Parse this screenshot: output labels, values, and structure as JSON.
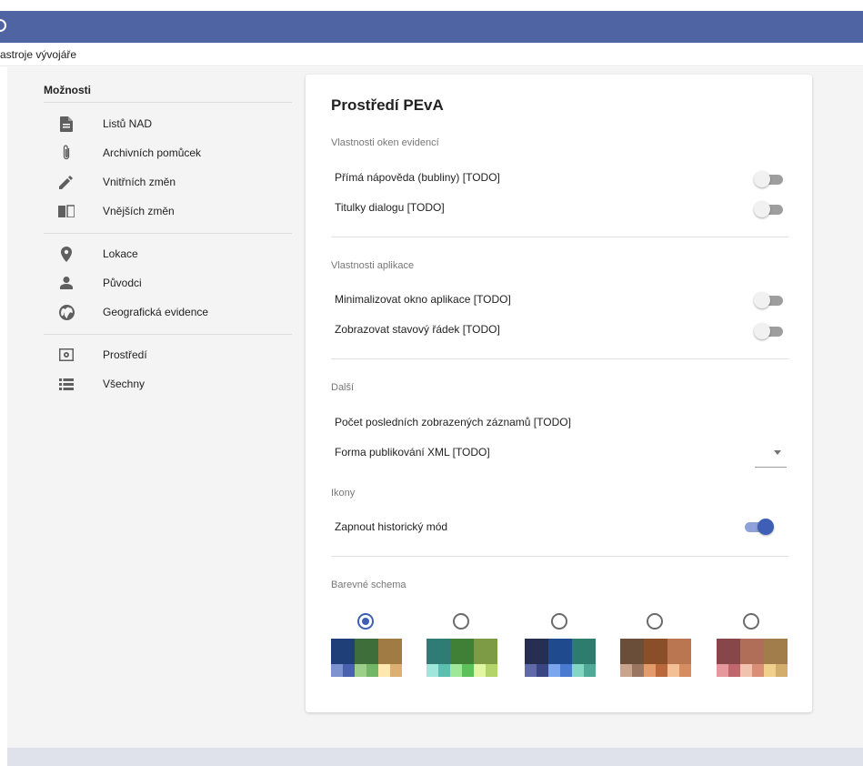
{
  "menubar": {
    "title": "astroje vývojáře"
  },
  "sidebar": {
    "title": "Možnosti",
    "groups": [
      [
        {
          "label": "Listů NAD",
          "icon": "document-icon"
        },
        {
          "label": "Archivních pomůcek",
          "icon": "paperclip-icon"
        },
        {
          "label": "Vnitřních změn",
          "icon": "pencil-icon"
        },
        {
          "label": "Vnějších změn",
          "icon": "book-icon"
        }
      ],
      [
        {
          "label": "Lokace",
          "icon": "location-pin-icon"
        },
        {
          "label": "Původci",
          "icon": "person-icon"
        },
        {
          "label": "Geografická evidence",
          "icon": "globe-icon"
        }
      ],
      [
        {
          "label": "Prostředí",
          "icon": "settings-panel-icon"
        },
        {
          "label": "Všechny",
          "icon": "list-icon"
        }
      ]
    ]
  },
  "main": {
    "title": "Prostředí PEvA",
    "sections": {
      "window_props": {
        "label": "Vlastnosti oken evidencí",
        "rows": [
          {
            "label": "Přímá nápověda (bubliny) [TODO]",
            "enabled": false
          },
          {
            "label": "Titulky dialogu [TODO]",
            "enabled": false
          }
        ]
      },
      "app_props": {
        "label": "Vlastnosti aplikace",
        "rows": [
          {
            "label": "Minimalizovat okno aplikace [TODO]",
            "enabled": false
          },
          {
            "label": "Zobrazovat stavový řádek [TODO]",
            "enabled": false
          }
        ]
      },
      "other": {
        "label": "Další",
        "recent_count_label": "Počet posledních zobrazených záznamů [TODO]",
        "xml_form_label": "Forma publikování XML [TODO]",
        "xml_form_value": ""
      },
      "icons": {
        "label": "Ikony",
        "historic_mode_label": "Zapnout historický mód",
        "historic_mode_enabled": true
      },
      "color_scheme": {
        "label": "Barevné schema",
        "selected_index": 0,
        "schemes": [
          {
            "big": [
              "#1f3f78",
              "#3e6e3a",
              "#a07c44"
            ],
            "small": [
              "#7c93cf",
              "#4a61b0",
              "#9ecf8a",
              "#74b667",
              "#ffe8b0",
              "#dcb070"
            ]
          },
          {
            "big": [
              "#2e7c75",
              "#3f7f36",
              "#7d9a44"
            ],
            "small": [
              "#9fe6dc",
              "#5bbfb1",
              "#9fe89a",
              "#5dc15b",
              "#e2f7a2",
              "#b3d46a"
            ]
          },
          {
            "big": [
              "#262e52",
              "#1f4b8e",
              "#2e7c6d"
            ],
            "small": [
              "#5f6aa7",
              "#3a4583",
              "#7aa6ee",
              "#4b7bd1",
              "#83d6c2",
              "#4ea996"
            ]
          },
          {
            "big": [
              "#6a4e3a",
              "#8a4e28",
              "#b97650"
            ],
            "small": [
              "#c9a48d",
              "#9a7661",
              "#e59a6b",
              "#b9683c",
              "#f3bf95",
              "#d68e61"
            ]
          },
          {
            "big": [
              "#86464a",
              "#b06d58",
              "#a17d4c"
            ],
            "small": [
              "#e5999d",
              "#c0676e",
              "#f1c3af",
              "#d98e75",
              "#f1d08c",
              "#d2ad6b"
            ]
          }
        ]
      }
    }
  }
}
